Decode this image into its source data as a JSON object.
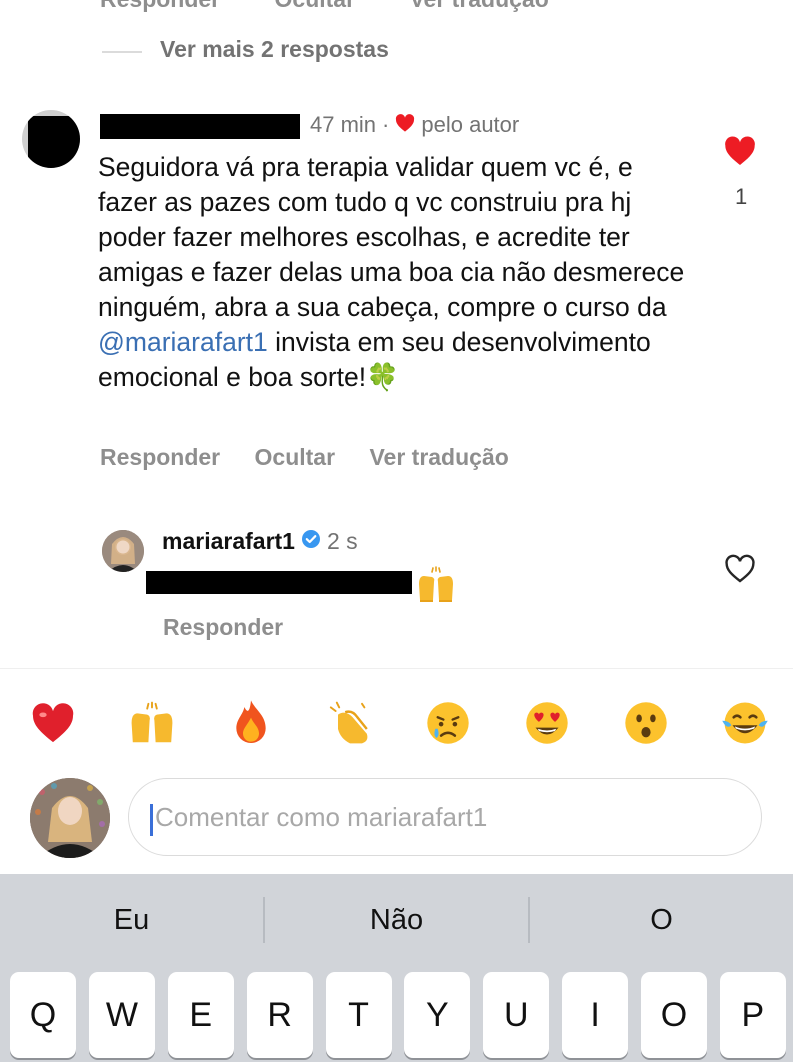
{
  "top_actions": [
    "Responder",
    "Ocultar",
    "Ver tradução"
  ],
  "view_more": "Ver mais 2 respostas",
  "comment": {
    "time": "47 min",
    "separator": "·",
    "liked_by_author": "pelo autor",
    "text_before_mention": "Seguidora vá pra terapia validar quem vc é, e fazer as pazes com tudo q vc construiu pra hj poder fazer melhores escolhas, e acredite ter amigas e fazer delas uma boa cia não desmerece ninguém, abra a sua cabeça, compre o curso da ",
    "mention": "@mariarafart1",
    "text_after_mention": " invista em seu desenvolvimento emocional e boa sorte!",
    "emoji": "🍀",
    "like_count": "1",
    "actions": {
      "reply": "Responder",
      "hide": "Ocultar",
      "translate": "Ver tradução"
    }
  },
  "reply": {
    "username": "mariarafart1",
    "time": "2 s",
    "emoji": "🙌",
    "action_reply": "Responder"
  },
  "emoji_bar": [
    "❤️",
    "🙌",
    "🔥",
    "👏",
    "😢",
    "😍",
    "😮",
    "😂"
  ],
  "composer": {
    "placeholder": "Comentar como mariarafart1"
  },
  "keyboard": {
    "suggestions": [
      "Eu",
      "Não",
      "O"
    ],
    "top_row": [
      "Q",
      "W",
      "E",
      "R",
      "T",
      "Y",
      "U",
      "I",
      "O",
      "P"
    ]
  },
  "colors": {
    "like_red": "#ed1c24",
    "mention_blue": "#3a6fb3",
    "verified_blue": "#3897f0",
    "keyboard_bg": "#d1d4d9"
  }
}
